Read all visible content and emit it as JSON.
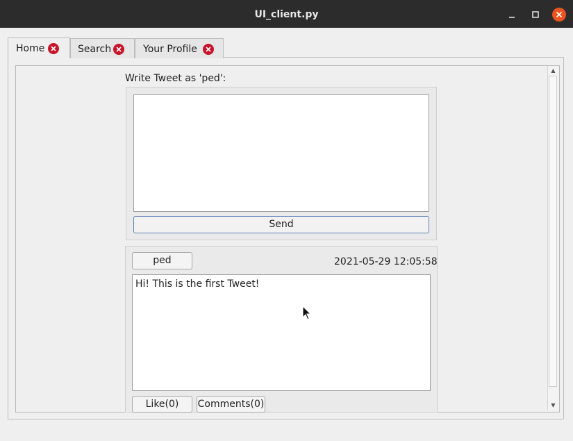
{
  "window": {
    "title": "UI_client.py"
  },
  "tabs": [
    {
      "label": "Home"
    },
    {
      "label": "Search"
    },
    {
      "label": "Your Profile"
    }
  ],
  "compose": {
    "label": "Write Tweet as 'ped':",
    "text": "",
    "send_label": "Send"
  },
  "tweet": {
    "author": "ped",
    "date": "2021-05-29 12:05:58",
    "text": "Hi! This is the first Tweet!",
    "like_label": "Like(0)",
    "comments_label": "Comments(0)"
  },
  "colors": {
    "accent": "#e95420",
    "tab_close": "#c7162b",
    "titlebar": "#2c2c2c"
  },
  "icons": [
    "minimize-icon",
    "maximize-icon",
    "close-icon",
    "tab-close-icon",
    "mouse-pointer-icon"
  ]
}
